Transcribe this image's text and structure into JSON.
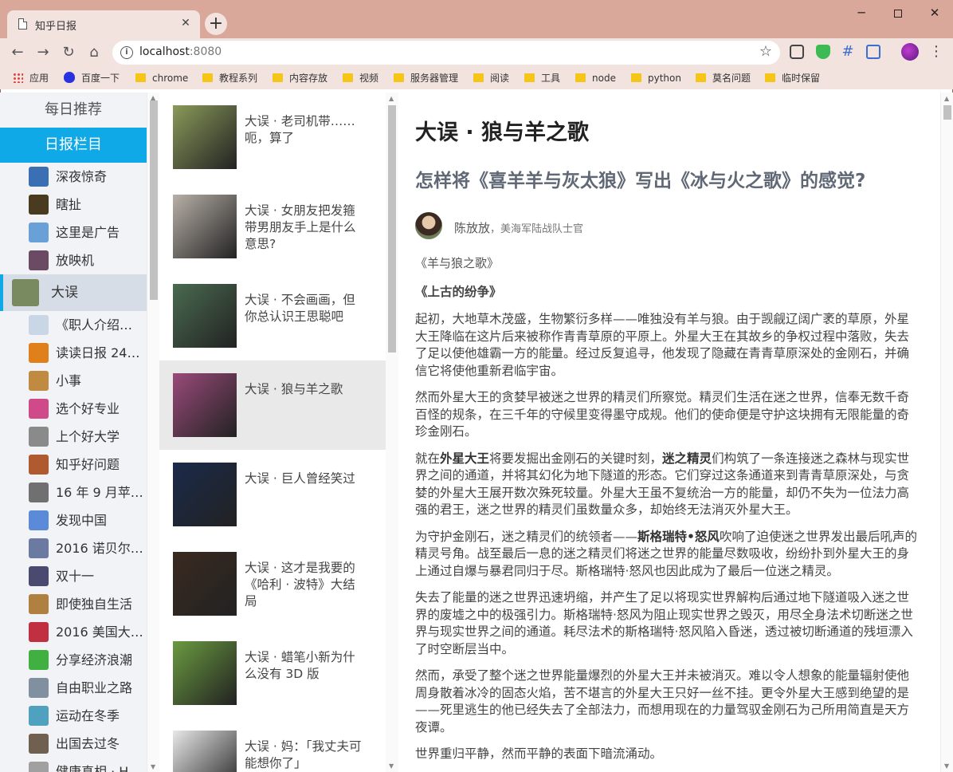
{
  "browser": {
    "tab_title": "知乎日报",
    "tab_close": "✕",
    "new_tab": "+",
    "url_host": "localhost",
    "url_port": ":8080",
    "bookmarks": [
      "应用",
      "百度一下",
      "chrome",
      "教程系列",
      "内容存放",
      "视频",
      "服务器管理",
      "阅读",
      "工具",
      "node",
      "python",
      "莫名问题",
      "临时保留"
    ]
  },
  "sidebar": {
    "recommend_label": "每日推荐",
    "columns_label": "日报栏目",
    "items": [
      {
        "label": "深夜惊奇",
        "thumb": "#3a6fb3"
      },
      {
        "label": "瞎扯",
        "thumb": "#4a3a20"
      },
      {
        "label": "这里是广告",
        "thumb": "#6aa0d8"
      },
      {
        "label": "放映机",
        "thumb": "#6b4a63"
      },
      {
        "label": "大误",
        "thumb": "#7a8a60",
        "selected": true
      },
      {
        "label": "《职人介绍…",
        "thumb": "#c9d6e6"
      },
      {
        "label": "读读日报 24…",
        "thumb": "#e0801a"
      },
      {
        "label": "小事",
        "thumb": "#c08a40"
      },
      {
        "label": "选个好专业",
        "thumb": "#d04a8a"
      },
      {
        "label": "上个好大学",
        "thumb": "#8a8a8a"
      },
      {
        "label": "知乎好问题",
        "thumb": "#b05a30"
      },
      {
        "label": "16 年 9 月苹…",
        "thumb": "#707070"
      },
      {
        "label": "发现中国",
        "thumb": "#5a8ad8"
      },
      {
        "label": "2016 诺贝尔…",
        "thumb": "#6a7aa0"
      },
      {
        "label": "双十一",
        "thumb": "#4a4a70"
      },
      {
        "label": "即使独自生活",
        "thumb": "#b08040"
      },
      {
        "label": "2016 美国大…",
        "thumb": "#c03040"
      },
      {
        "label": "分享经济浪潮",
        "thumb": "#40b040"
      },
      {
        "label": "自由职业之路",
        "thumb": "#8090a0"
      },
      {
        "label": "运动在冬季",
        "thumb": "#50a0c0"
      },
      {
        "label": "出国去过冬",
        "thumb": "#706050"
      },
      {
        "label": "健康真相 · H…",
        "thumb": "#a0a0a0"
      }
    ]
  },
  "stories": [
    {
      "title": "大误 · 老司机带……呃，算了",
      "thumb": "#8a9a5a"
    },
    {
      "title": "大误 · 女朋友把发箍带男朋友手上是什么意思?",
      "thumb": "#b8b0a8"
    },
    {
      "title": "大误 · 不会画画，但你总认识王思聪吧",
      "thumb": "#4a6a50"
    },
    {
      "title": "大误 · 狼与羊之歌",
      "thumb": "#9a4a7a",
      "active": true
    },
    {
      "title": "大误 · 巨人曾经笑过",
      "thumb": "#1a2a4a"
    },
    {
      "title": "大误 · 这才是我要的《哈利 · 波特》大结局",
      "thumb": "#3a2a20"
    },
    {
      "title": "大误 · 蜡笔小新为什么没有 3D 版",
      "thumb": "#6a9a40"
    },
    {
      "title": "大误 · 妈：「我丈夫可能想你了」",
      "thumb": "#e8e8e8"
    }
  ],
  "article": {
    "title": "大误 · 狼与羊之歌",
    "question": "怎样将《喜羊羊与灰太狼》写出《冰与火之歌》的感觉?",
    "author_name": "陈放放",
    "author_bio": "，美海军陆战队士官",
    "poem_title": "《羊与狼之歌》",
    "section": "《上古的纷争》",
    "p1": "起初，大地草木茂盛，生物繁衍多样——唯独没有羊与狼。由于觊觎辽阔广袤的草原，外星大王降临在这片后来被称作青青草原的平原上。外星大王在其故乡的争权过程中落败，失去了足以使他雄霸一方的能量。经过反复追寻，他发现了隐藏在青青草原深处的金刚石，并确信它将使他重新君临宇宙。",
    "p2": "然而外星大王的贪婪早被迷之世界的精灵们所察觉。精灵们生活在迷之世界，信奉无数千奇百怪的规条，在三千年的守候里变得墨守成规。他们的使命便是守护这块拥有无限能量的奇珍金刚石。",
    "p3a": "就在",
    "p3b": "外星大王",
    "p3c": "将要发掘出金刚石的关键时刻，",
    "p3d": "迷之精灵",
    "p3e": "们构筑了一条连接迷之森林与现实世界之间的通道，并将其幻化为地下隧道的形态。它们穿过这条通道来到青青草原深处，与贪婪的外星大王展开数次殊死较量。外星大王虽不复统治一方的能量，却仍不失为一位法力高强的君王，迷之世界的精灵们虽数量众多，却始终无法消灭外星大王。",
    "p4a": "为守护金刚石，迷之精灵们的统领者——",
    "p4b": "斯格瑞特•怒风",
    "p4c": "吹响了迫使迷之世界发出最后吼声的精灵号角。战至最后一息的迷之精灵们将迷之世界的能量尽数吸收，纷纷扑到外星大王的身上通过自爆与暴君同归于尽。斯格瑞特·怒风也因此成为了最后一位迷之精灵。",
    "p5": "失去了能量的迷之世界迅速坍缩，并产生了足以将现实世界解构后通过地下隧道吸入迷之世界的废墟之中的极强引力。斯格瑞特·怒风为阻止现实世界之毁灭，用尽全身法术切断迷之世界与现实世界之间的通道。耗尽法术的斯格瑞特·怒风陷入昏迷，透过被切断通道的残垣漂入了时空断层当中。",
    "p6": "然而，承受了整个迷之世界能量爆烈的外星大王并未被消灭。难以令人想象的能量辐射使他周身散着冰冷的固态火焰，苦不堪言的外星大王只好一丝不挂。更令外星大王感到绝望的是——死里逃生的他已经失去了全部法力，而想用现在的力量驾驭金刚石为己所用简直是天方夜谭。",
    "p7": "世界重归平静，然而平静的表面下暗流涌动。"
  }
}
